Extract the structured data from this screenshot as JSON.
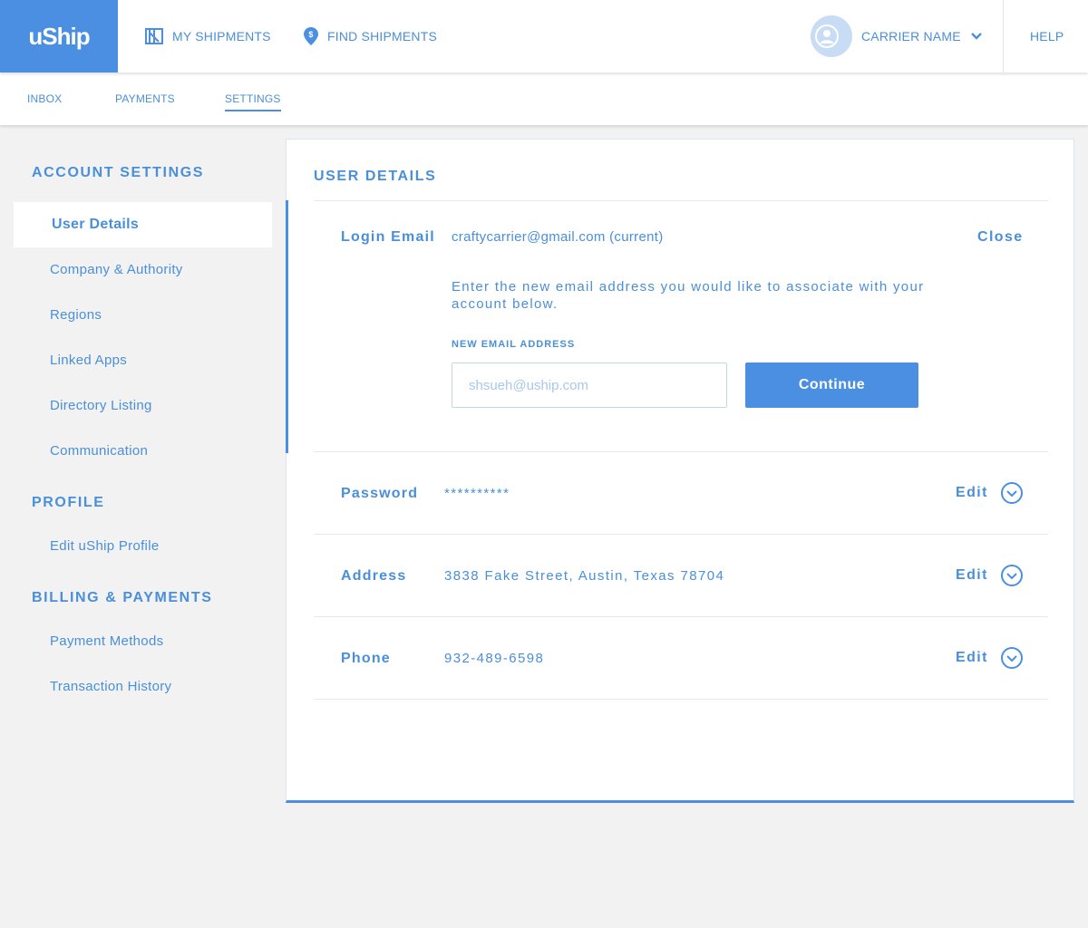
{
  "brand": {
    "logo_text": "uShip",
    "accent": "#4a8fe2",
    "text_color": "#4a8fd9"
  },
  "topnav": {
    "my_shipments": {
      "label": "MY SHIPMENTS",
      "icon": "shipments-icon"
    },
    "find_shipments": {
      "label": "FIND SHIPMENTS",
      "icon": "location-pin-icon"
    },
    "user": {
      "name": "CARRIER NAME",
      "icon": "avatar-icon"
    },
    "help": "HELP"
  },
  "subnav": {
    "tabs": [
      {
        "label": "INBOX",
        "active": false
      },
      {
        "label": "PAYMENTS",
        "active": false
      },
      {
        "label": "SETTINGS",
        "active": true
      }
    ]
  },
  "sidebar": {
    "account_heading": "ACCOUNT SETTINGS",
    "account_items": [
      "User Details",
      "Company & Authority",
      "Regions",
      "Linked Apps",
      "Directory Listing",
      "Communication"
    ],
    "profile_heading": "PROFILE",
    "profile_items": [
      "Edit uShip Profile"
    ],
    "billing_heading": "BILLING & PAYMENTS",
    "billing_items": [
      "Payment Methods",
      "Transaction History"
    ]
  },
  "main": {
    "title": "USER DETAILS",
    "login": {
      "label": "Login Email",
      "value": "craftycarrier@gmail.com (current)",
      "close_label": "Close",
      "instructions": "Enter the new email address you would like to associate with your account below.",
      "field_label": "NEW EMAIL ADDRESS",
      "placeholder": "shsueh@uship.com",
      "continue_label": "Continue"
    },
    "rows": [
      {
        "label": "Password",
        "value": "**********",
        "action": "Edit"
      },
      {
        "label": "Address",
        "value": "3838 Fake Street, Austin, Texas 78704",
        "action": "Edit"
      },
      {
        "label": "Phone",
        "value": "932-489-6598",
        "action": "Edit"
      }
    ]
  }
}
